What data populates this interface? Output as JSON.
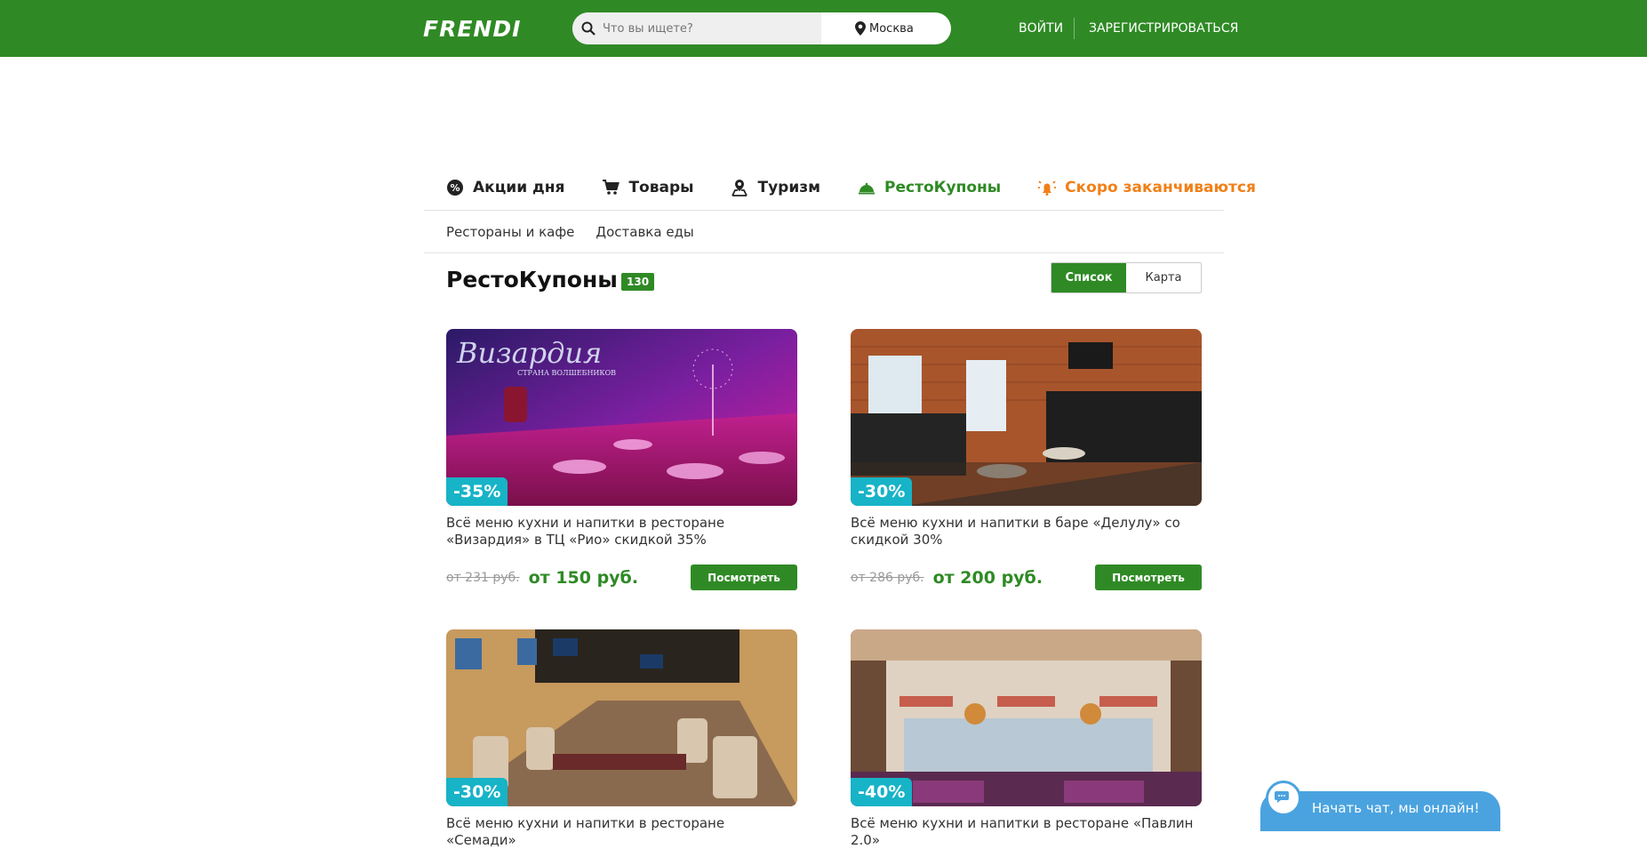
{
  "header": {
    "logo": "FRENDI",
    "search_placeholder": "Что вы ищете?",
    "city": "Москва",
    "login": "ВОЙТИ",
    "register": "ЗАРЕГИСТРИРОВАТЬСЯ"
  },
  "categories": [
    {
      "label": "Акции дня",
      "icon": "percent-badge-icon"
    },
    {
      "label": "Товары",
      "icon": "cart-icon"
    },
    {
      "label": "Туризм",
      "icon": "map-pin-icon"
    },
    {
      "label": "РестоКупоны",
      "icon": "cloche-icon",
      "active": true
    },
    {
      "label": "Скоро заканчиваются",
      "icon": "alarm-icon"
    }
  ],
  "subnav": [
    "Рестораны и кафе",
    "Доставка еды"
  ],
  "page": {
    "title": "РестоКупоны",
    "count": "130",
    "view_list": "Список",
    "view_map": "Карта"
  },
  "cards": [
    {
      "discount": "-35%",
      "title": "Всё меню кухни и напитки в ресторане «Визардия» в ТЦ «Рио» скидкой 35%",
      "old_price": "от 231 руб.",
      "price": "от 150 руб.",
      "button": "Посмотреть",
      "image_text": "Визардия",
      "image_subtext": "СТРАНА ВОЛШЕБНИКОВ"
    },
    {
      "discount": "-30%",
      "title": "Всё меню кухни и напитки в баре «Делулу» со скидкой 30%",
      "old_price": "от 286 руб.",
      "price": "от 200 руб.",
      "button": "Посмотреть"
    },
    {
      "discount": "-30%",
      "title": "Всё меню кухни и напитки в ресторане «Семади»",
      "old_price": "",
      "price": "",
      "button": ""
    },
    {
      "discount": "-40%",
      "title": "Всё меню кухни и напитки в ресторане «Павлин 2.0»",
      "old_price": "",
      "price": "",
      "button": ""
    }
  ],
  "chat": {
    "label": "Начать чат, мы онлайн!"
  },
  "colors": {
    "brand": "#2f8a25",
    "discount": "#17b3c7",
    "accent_orange": "#f08019",
    "chat": "#4aa3df"
  }
}
